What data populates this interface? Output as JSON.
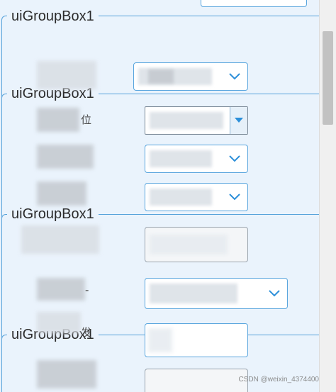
{
  "group_boxes": [
    {
      "title": "uiGroupBox1"
    },
    {
      "title": "uiGroupBox1"
    },
    {
      "title": "uiGroupBox1"
    },
    {
      "title": "uiGroupBox1"
    }
  ],
  "labels": {
    "row2_suffix": "位",
    "row7_suffix": "-",
    "row8_suffix": "发"
  },
  "footer": {
    "watermark": "CSDN @weixin_4374400"
  },
  "colors": {
    "accent": "#56a2da",
    "panel_bg": "#eaf3fc",
    "dropdown_arrow": "#2c8fd9"
  },
  "icons": {
    "dropdown": "chevron-down-icon",
    "dropdown_triangle": "triangle-down-icon"
  }
}
